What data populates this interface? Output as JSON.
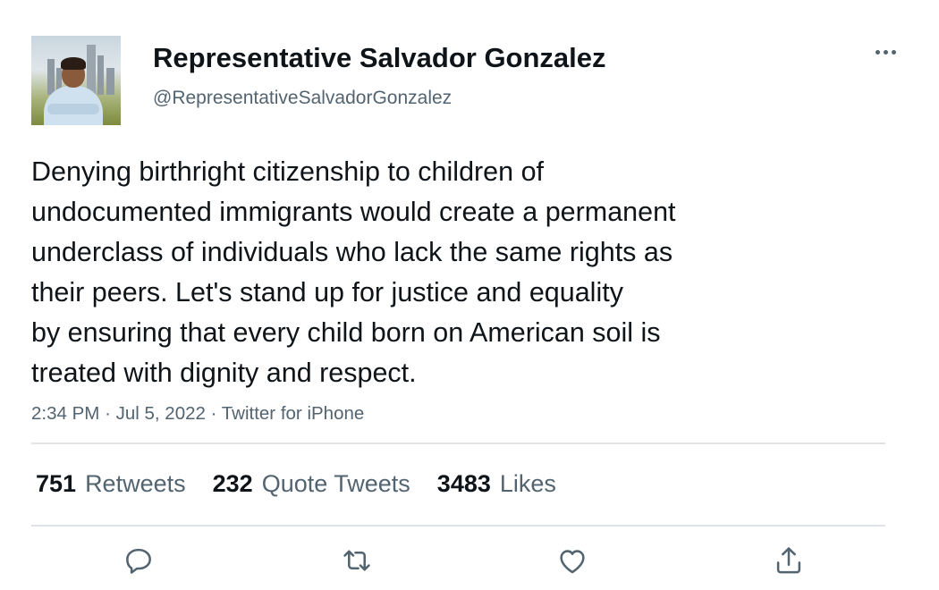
{
  "account": {
    "name": "Representative Salvador Gonzalez",
    "handle": "@RepresentativeSalvadorGonzalez"
  },
  "tweet": {
    "lines": [
      "Denying birthright citizenship to children of",
      "undocumented immigrants would create a permanent",
      "underclass of individuals who lack the same rights as",
      "their peers. Let's stand up for justice and equality",
      "by ensuring that every child born on American soil is",
      "treated with dignity and respect."
    ],
    "time": "2:34 PM",
    "sep1": "·",
    "date": "Jul 5, 2022",
    "sep2": "·",
    "source": "Twitter for iPhone"
  },
  "stats": {
    "retweets_count": "751",
    "retweets_label": "Retweets",
    "quotes_count": "232",
    "quotes_label": "Quote Tweets",
    "likes_count": "3483",
    "likes_label": "Likes"
  },
  "icons": {
    "more": "more-horizontal-icon",
    "reply": "reply-icon",
    "retweet": "retweet-icon",
    "like": "heart-icon",
    "share": "share-icon"
  },
  "colors": {
    "text_primary": "#0f1419",
    "text_secondary": "#536471",
    "divider": "#dfe3e6",
    "icon": "#536471"
  }
}
